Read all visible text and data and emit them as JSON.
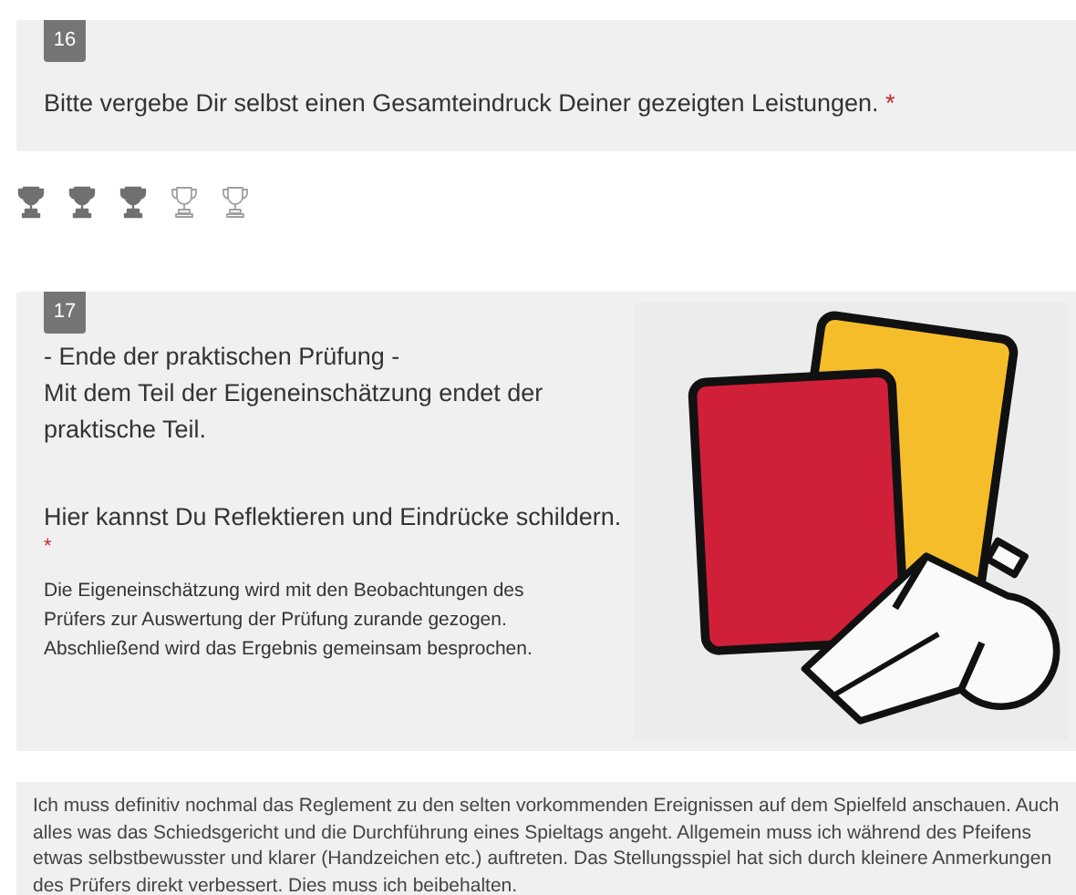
{
  "question_16": {
    "number": "16",
    "text": "Bitte vergebe Dir selbst einen Gesamteindruck Deiner gezeigten Leistungen.",
    "required_mark": "*"
  },
  "rating": {
    "stars": 3
  },
  "question_17": {
    "number": "17",
    "lines": [
      "- Ende der praktischen Prüfung -",
      "Mit dem Teil der Eigeneinschätzung endet der praktische Teil."
    ],
    "prompt": "Hier kannst Du Reflektieren und Eindrücke schildern.",
    "required_mark": "*",
    "note": "Die Eigeneinschätzung wird mit den Beobachtungen des Prüfers zur Auswertung der Prüfung zurande gezogen. Abschließend wird das Ergebnis gemeinsam besprochen."
  },
  "answer": {
    "value": "Ich muss definitiv nochmal das Reglement zu den selten vorkommenden Ereignissen auf dem Spielfeld anschauen. Auch alles was das Schiedsgericht und die Durchführung eines Spieltags angeht. Allgemein muss ich während des Pfeifens etwas selbstbewusster und klarer (Handzeichen etc.) auftreten. Das Stellungsspiel hat sich durch kleinere Anmerkungen des Prüfers direkt verbessert. Dies muss ich beibehalten."
  }
}
